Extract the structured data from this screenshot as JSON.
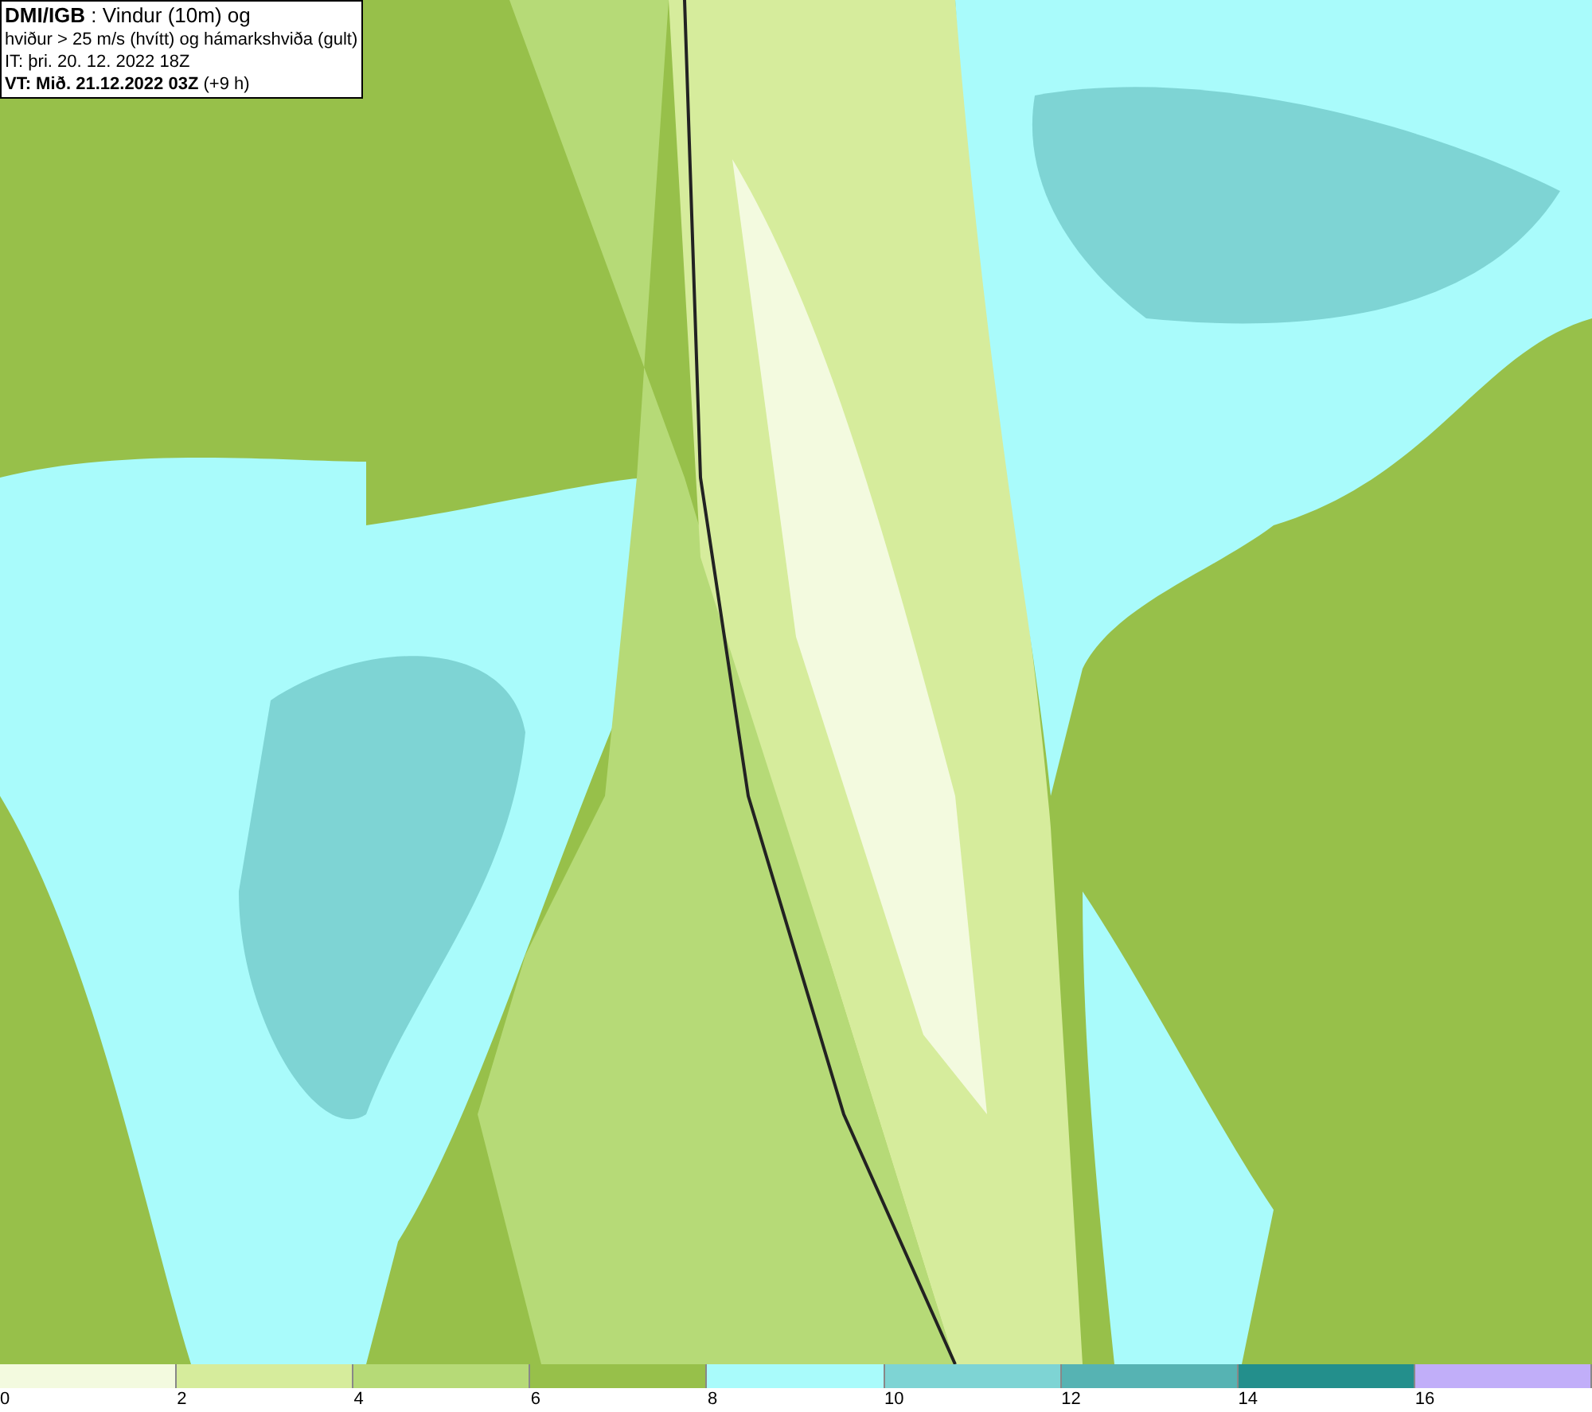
{
  "title_box": {
    "lines": [
      "**DMI/IGB** : Vindur (10m) og",
      "hviður > 25 m/s (hvítt) og hámarkshviða (gult)",
      "IT: þri. 20. 12. 2022 18Z",
      "**VT: Mið. 21.12.2022 03Z** (+9 h)"
    ]
  },
  "legend": [
    {
      "label": "0",
      "color": "#f3fadf"
    },
    {
      "label": "2",
      "color": "#d6ec9c"
    },
    {
      "label": "4",
      "color": "#b6da77"
    },
    {
      "label": "6",
      "color": "#97c04a"
    },
    {
      "label": "8",
      "color": "#a9fbfb"
    },
    {
      "label": "10",
      "color": "#7ed4d4"
    },
    {
      "label": "12",
      "color": "#56b3b3"
    },
    {
      "label": "14",
      "color": "#238f8c"
    },
    {
      "label": "16",
      "color": "#c1aef9"
    }
  ]
}
